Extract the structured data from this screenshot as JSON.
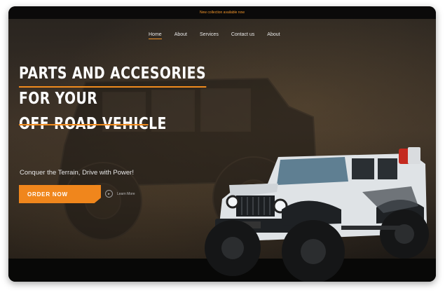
{
  "announcement": "New collection available now",
  "nav": {
    "items": [
      {
        "label": "Home",
        "active": true
      },
      {
        "label": "About",
        "active": false
      },
      {
        "label": "Services",
        "active": false
      },
      {
        "label": "Contact us",
        "active": false
      },
      {
        "label": "About",
        "active": false
      }
    ]
  },
  "hero": {
    "headline": [
      "PARTS AND ACCESORIES",
      "FOR YOUR",
      "OFF ROAD VEHICLE"
    ],
    "tagline": "Conquer the Terrain, Drive with Power!",
    "order_button": "ORDER NOW",
    "learn_more": "Learn More",
    "learn_more_icon": "play-circle-icon",
    "accent_color": "#f0861c"
  },
  "icons": {
    "hero_vehicle": "offroad-jeep-image",
    "background_vehicle": "muddy-jeep-background"
  }
}
